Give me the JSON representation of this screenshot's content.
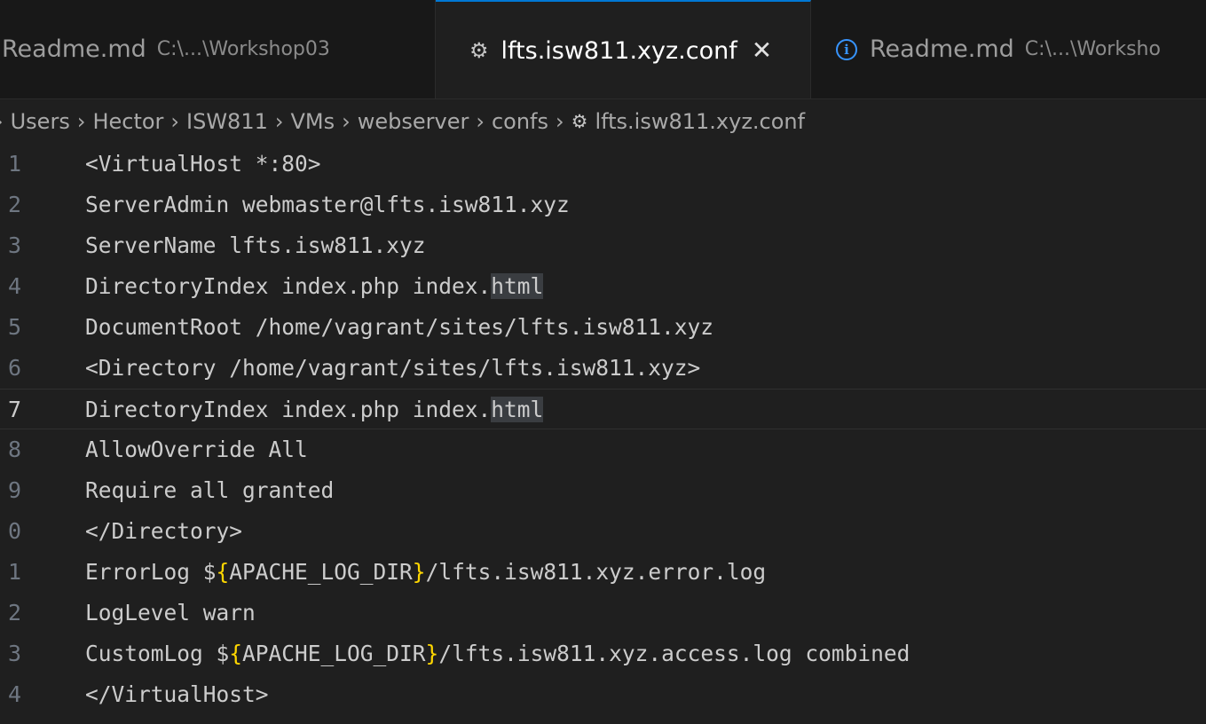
{
  "tabs": [
    {
      "name": "Readme.md",
      "desc": "C:\\...\\Workshop03",
      "icon": "none"
    },
    {
      "name": "lfts.isw811.xyz.conf",
      "icon": "gear-icon",
      "close": "✕",
      "active": true
    },
    {
      "name": "Readme.md",
      "desc": "C:\\...\\Worksho",
      "icon": "info-icon"
    }
  ],
  "breadcrumb": {
    "segments": [
      "Users",
      "Hector",
      "ISW811",
      "VMs",
      "webserver",
      "confs"
    ],
    "file": "lfts.isw811.xyz.conf",
    "file_icon": "gear-icon"
  },
  "editor": {
    "current_line": 7,
    "lines": [
      {
        "num": "1",
        "parts": [
          "<VirtualHost *:80>"
        ]
      },
      {
        "num": "2",
        "parts": [
          "ServerAdmin webmaster@lfts.isw811.xyz"
        ]
      },
      {
        "num": "3",
        "parts": [
          "ServerName lfts.isw811.xyz"
        ]
      },
      {
        "num": "4",
        "parts": [
          "DirectoryIndex index.php index.",
          "html"
        ],
        "highlight_last": true
      },
      {
        "num": "5",
        "parts": [
          "DocumentRoot /home/vagrant/sites/lfts.isw811.xyz"
        ]
      },
      {
        "num": "6",
        "parts": [
          "<Directory /home/vagrant/sites/lfts.isw811.xyz>"
        ]
      },
      {
        "num": "7",
        "parts": [
          "DirectoryIndex index.php index.",
          "html"
        ],
        "highlight_last": true
      },
      {
        "num": "8",
        "parts": [
          "AllowOverride All"
        ]
      },
      {
        "num": "9",
        "parts": [
          "Require all granted"
        ]
      },
      {
        "num": "0",
        "parts": [
          "</Directory>"
        ]
      },
      {
        "num": "1",
        "parts": [
          "ErrorLog $",
          "{",
          "APACHE_LOG_DIR",
          "}",
          "/lfts.isw811.xyz.error.log"
        ],
        "braces": true
      },
      {
        "num": "2",
        "parts": [
          "LogLevel warn"
        ]
      },
      {
        "num": "3",
        "parts": [
          "CustomLog $",
          "{",
          "APACHE_LOG_DIR",
          "}",
          "/lfts.isw811.xyz.access.log combined"
        ],
        "braces": true
      },
      {
        "num": "4",
        "parts": [
          "</VirtualHost>"
        ]
      }
    ]
  }
}
